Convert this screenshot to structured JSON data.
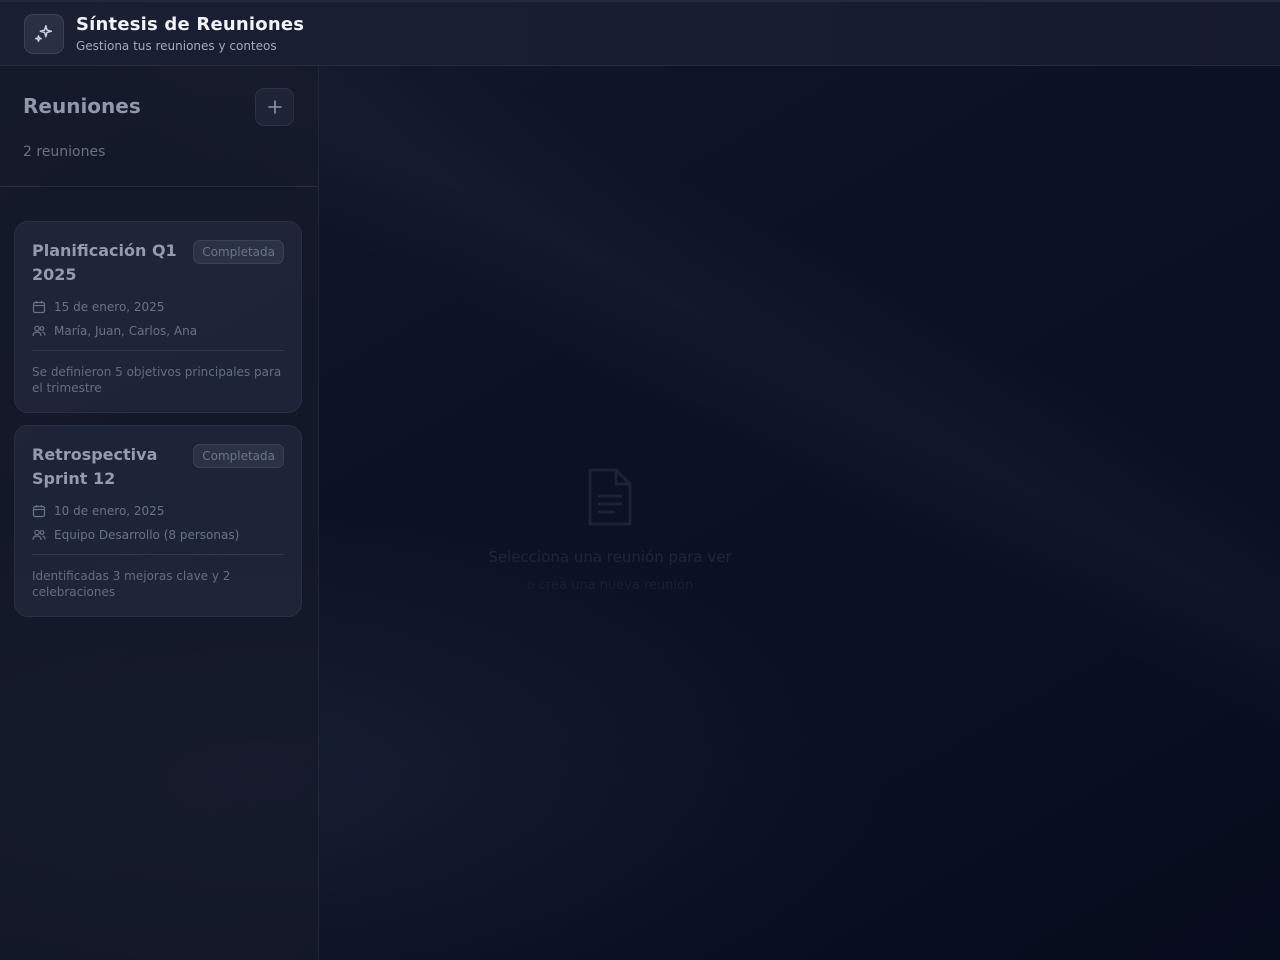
{
  "header": {
    "title": "Síntesis de Reuniones",
    "subtitle": "Gestiona tus reuniones y conteos",
    "logo_icon": "sparkles-icon"
  },
  "sidebar": {
    "title": "Reuniones",
    "add_button_icon": "plus-icon",
    "count_label": "2 reuniones",
    "meetings": [
      {
        "title": "Planificación Q1 2025",
        "status": "Completada",
        "date": "15 de enero, 2025",
        "participants": "María, Juan, Carlos, Ana",
        "summary": "Se definieron 5 objetivos principales para el trimestre"
      },
      {
        "title": "Retrospectiva Sprint 12",
        "status": "Completada",
        "date": "10 de enero, 2025",
        "participants": "Equipo Desarrollo (8 personas)",
        "summary": "Identificadas 3 mejoras clave y 2 celebraciones"
      }
    ]
  },
  "main": {
    "empty_icon": "document-icon",
    "empty_title": "Selecciona una reunión para ver",
    "empty_subtitle": "o crea una nueva reunión"
  },
  "colors": {
    "background": "#0a1022",
    "header": "#1a1f32",
    "card": "#212739",
    "badge": "#2c3246"
  }
}
